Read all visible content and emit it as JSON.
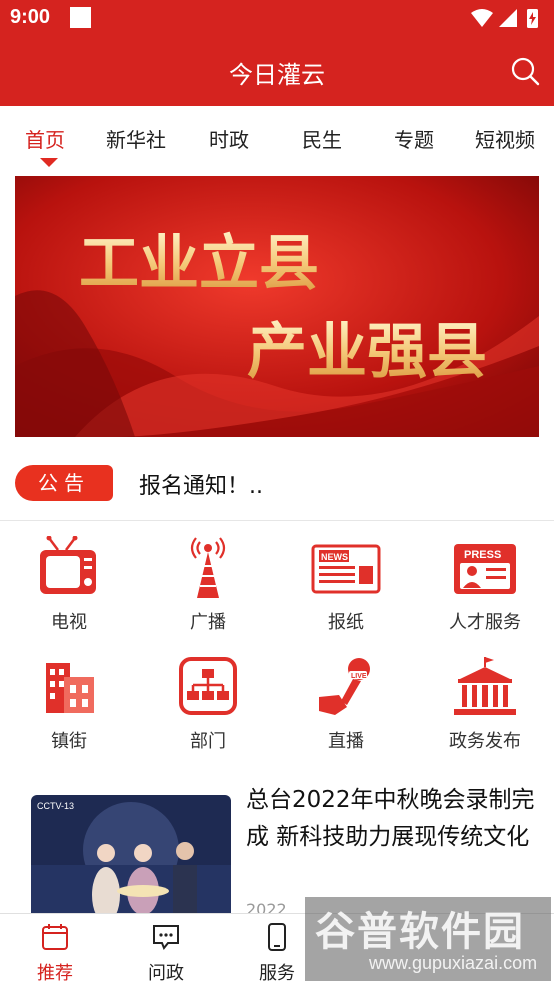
{
  "status_bar": {
    "time": "9:00"
  },
  "header": {
    "title": "今日灌云"
  },
  "tabs": [
    {
      "label": "首页",
      "active": true
    },
    {
      "label": "新华社"
    },
    {
      "label": "时政"
    },
    {
      "label": "民生"
    },
    {
      "label": "专题"
    },
    {
      "label": "短视频"
    }
  ],
  "banner": {
    "line1": "工业立县",
    "line2": "产业强县"
  },
  "notice": {
    "badge": "公告",
    "text": "报名通知！.."
  },
  "grid": [
    {
      "label": "电视",
      "icon": "tv-icon"
    },
    {
      "label": "广播",
      "icon": "radio-tower-icon"
    },
    {
      "label": "报纸",
      "icon": "newspaper-icon"
    },
    {
      "label": "人才服务",
      "icon": "press-card-icon"
    },
    {
      "label": "镇街",
      "icon": "buildings-icon"
    },
    {
      "label": "部门",
      "icon": "org-chart-icon"
    },
    {
      "label": "直播",
      "icon": "live-microphone-icon"
    },
    {
      "label": "政务发布",
      "icon": "government-building-icon"
    }
  ],
  "news": {
    "headline": "总台2022年中秋晚会录制完成 新科技助力展现传统文化",
    "date_partial": "2022",
    "thumb_logo": "CCTV-13"
  },
  "bottom_nav": [
    {
      "label": "推荐",
      "icon": "calendar-icon",
      "active": true
    },
    {
      "label": "问政",
      "icon": "chat-bubble-icon"
    },
    {
      "label": "服务",
      "icon": "phone-icon"
    }
  ],
  "watermark": {
    "title": "谷普软件园",
    "url": "www.gupuxiazai.com"
  },
  "colors": {
    "primary": "#d5231f",
    "accent": "#e8311f"
  }
}
